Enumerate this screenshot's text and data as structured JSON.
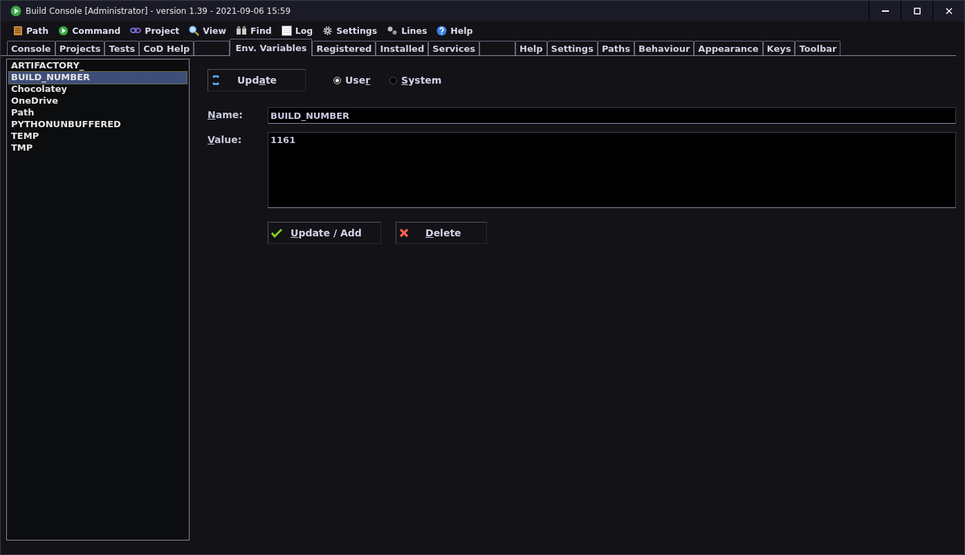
{
  "window": {
    "title": "Build Console [Administrator] - version 1.39 - 2021-09-06 15:59"
  },
  "menu": [
    {
      "label": "Path"
    },
    {
      "label": "Command"
    },
    {
      "label": "Project"
    },
    {
      "label": "View"
    },
    {
      "label": "Find"
    },
    {
      "label": "Log"
    },
    {
      "label": "Settings"
    },
    {
      "label": "Lines"
    },
    {
      "label": "Help"
    }
  ],
  "tabs": [
    {
      "kind": "text",
      "label": "Console",
      "selected": false
    },
    {
      "kind": "text",
      "label": "Projects",
      "selected": false
    },
    {
      "kind": "text",
      "label": "Tests",
      "selected": false
    },
    {
      "kind": "text",
      "label": "CoD Help",
      "selected": false
    },
    {
      "kind": "blank",
      "selected": false
    },
    {
      "kind": "text",
      "label": "Env. Variables",
      "selected": true
    },
    {
      "kind": "text",
      "label": "Registered",
      "selected": false
    },
    {
      "kind": "text",
      "label": "Installed",
      "selected": false
    },
    {
      "kind": "text",
      "label": "Services",
      "selected": false
    },
    {
      "kind": "blank",
      "selected": false
    },
    {
      "kind": "text",
      "label": "Help",
      "selected": false
    },
    {
      "kind": "text",
      "label": "Settings",
      "selected": false
    },
    {
      "kind": "text",
      "label": "Paths",
      "selected": false
    },
    {
      "kind": "text",
      "label": "Behaviour",
      "selected": false
    },
    {
      "kind": "text",
      "label": "Appearance",
      "selected": false
    },
    {
      "kind": "text",
      "label": "Keys",
      "selected": false
    },
    {
      "kind": "text",
      "label": "Toolbar",
      "selected": false
    }
  ],
  "variables": [
    {
      "name": "ARTIFACTORY_",
      "selected": false
    },
    {
      "name": "BUILD_NUMBER",
      "selected": true
    },
    {
      "name": "Chocolatey",
      "selected": false
    },
    {
      "name": "OneDrive",
      "selected": false
    },
    {
      "name": "Path",
      "selected": false
    },
    {
      "name": "PYTHONUNBUFFERED",
      "selected": false
    },
    {
      "name": "TEMP",
      "selected": false
    },
    {
      "name": "TMP",
      "selected": false
    }
  ],
  "refresh_button": {
    "before": "Upd",
    "key": "a",
    "after": "te"
  },
  "scope": [
    {
      "before": "Use",
      "key": "r",
      "selected": true
    },
    {
      "key": "S",
      "after": "ystem",
      "selected": false
    }
  ],
  "name_field": {
    "label": {
      "key": "N",
      "after": "ame:"
    },
    "value": "BUILD_NUMBER"
  },
  "value_field": {
    "label": {
      "key": "V",
      "after": "alue:"
    },
    "value": "1161"
  },
  "actions": [
    {
      "kind": "confirm",
      "key": "U",
      "after": "pdate / Add"
    },
    {
      "kind": "delete",
      "key": "D",
      "after": "elete"
    }
  ]
}
